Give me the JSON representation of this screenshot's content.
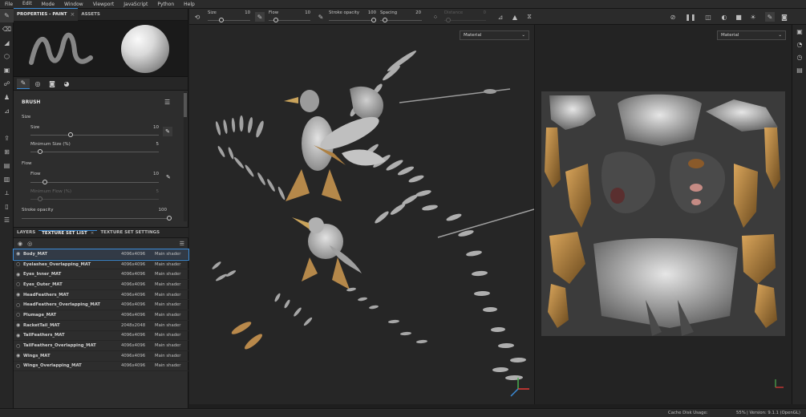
{
  "menu": [
    "File",
    "Edit",
    "Mode",
    "Window",
    "Viewport",
    "JavaScript",
    "Python",
    "Help"
  ],
  "left_panel": {
    "tabs": [
      {
        "label": "PROPERTIES - PAINT",
        "closable": true
      },
      {
        "label": "ASSETS",
        "closable": false
      }
    ],
    "brush": {
      "title": "BRUSH",
      "size_group": "Size",
      "size_label": "Size",
      "size_value": "10",
      "min_size_label": "Minimum Size (%)",
      "min_size_value": "5",
      "flow_group": "Flow",
      "flow_label": "Flow",
      "flow_value": "10",
      "min_flow_label": "Minimum Flow (%)",
      "min_flow_value": "5",
      "stroke_opacity_label": "Stroke opacity",
      "stroke_opacity_value": "100"
    },
    "layer_tabs": [
      {
        "label": "LAYERS",
        "closable": false
      },
      {
        "label": "TEXTURE SET LIST",
        "closable": true
      },
      {
        "label": "TEXTURE SET SETTINGS",
        "closable": false
      }
    ],
    "texture_sets": [
      {
        "name": "Body_MAT",
        "res": "4096x4096",
        "shader": "Main shader",
        "visible": true
      },
      {
        "name": "Eyelashes_Overlapping_MAT",
        "res": "4096x4096",
        "shader": "Main shader",
        "visible": false
      },
      {
        "name": "Eyes_Inner_MAT",
        "res": "4096x4096",
        "shader": "Main shader",
        "visible": true
      },
      {
        "name": "Eyes_Outer_MAT",
        "res": "4096x4096",
        "shader": "Main shader",
        "visible": false
      },
      {
        "name": "HeadFeathers_MAT",
        "res": "4096x4096",
        "shader": "Main shader",
        "visible": true
      },
      {
        "name": "HeadFeathers_Overlapping_MAT",
        "res": "4096x4096",
        "shader": "Main shader",
        "visible": false
      },
      {
        "name": "Plumage_MAT",
        "res": "4096x4096",
        "shader": "Main shader",
        "visible": false
      },
      {
        "name": "RacketTail_MAT",
        "res": "2048x2048",
        "shader": "Main shader",
        "visible": true
      },
      {
        "name": "TailFeathers_MAT",
        "res": "4096x4096",
        "shader": "Main shader",
        "visible": true
      },
      {
        "name": "TailFeathers_Overlapping_MAT",
        "res": "4096x4096",
        "shader": "Main shader",
        "visible": false
      },
      {
        "name": "Wings_MAT",
        "res": "4096x4096",
        "shader": "Main shader",
        "visible": true
      },
      {
        "name": "Wings_Overlapping_MAT",
        "res": "4096x4096",
        "shader": "Main shader",
        "visible": false
      }
    ]
  },
  "toolbar": {
    "size_label": "Size",
    "size_value": "10",
    "flow_label": "Flow",
    "flow_value": "10",
    "stroke_opacity_label": "Stroke opacity",
    "stroke_opacity_value": "100",
    "spacing_label": "Spacing",
    "spacing_value": "20",
    "distance_label": "Distance",
    "distance_value": "0"
  },
  "viewport": {
    "left_mode": "Material",
    "right_mode": "Material"
  },
  "status": {
    "cache_label": "Cache Disk Usage:",
    "cache_value": "55%",
    "version": "| Version: 9.1.1 (OpenGL)"
  },
  "colors": {
    "accent": "#3b8bd6",
    "panel": "#2d2d2d",
    "viewport": "#262626"
  }
}
